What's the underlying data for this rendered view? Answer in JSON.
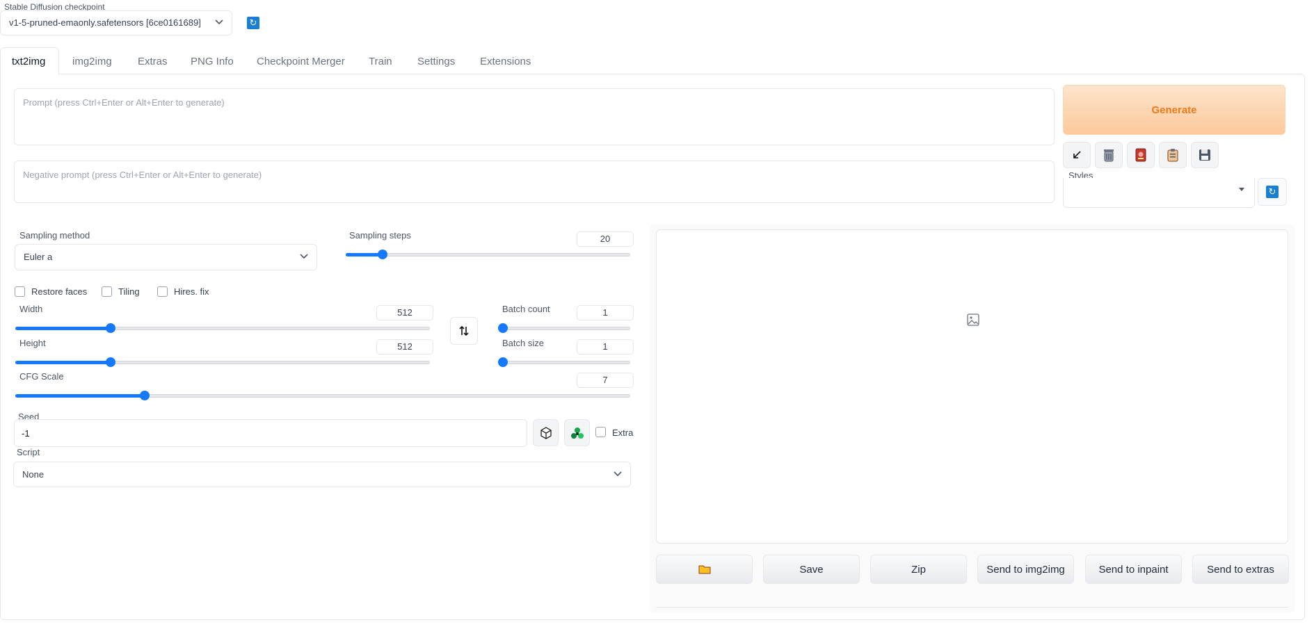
{
  "checkpoint": {
    "label": "Stable Diffusion checkpoint",
    "selected": "v1-5-pruned-emaonly.safetensors [6ce0161689]"
  },
  "tabs": [
    "txt2img",
    "img2img",
    "Extras",
    "PNG Info",
    "Checkpoint Merger",
    "Train",
    "Settings",
    "Extensions"
  ],
  "active_tab": "txt2img",
  "prompt": {
    "placeholder": "Prompt (press Ctrl+Enter or Alt+Enter to generate)",
    "value": ""
  },
  "negative_prompt": {
    "placeholder": "Negative prompt (press Ctrl+Enter or Alt+Enter to generate)",
    "value": ""
  },
  "generate_label": "Generate",
  "tool_icons": [
    "arrow-icon",
    "trash-icon",
    "red-card-icon",
    "clipboard-icon",
    "save-floppy-icon"
  ],
  "styles": {
    "label": "Styles",
    "selected": ""
  },
  "sampling_method": {
    "label": "Sampling method",
    "selected": "Euler a"
  },
  "sampling_steps": {
    "label": "Sampling steps",
    "value": "20",
    "fraction": 0.13
  },
  "checkboxes": {
    "restore_faces": "Restore faces",
    "tiling": "Tiling",
    "hires_fix": "Hires. fix"
  },
  "width": {
    "label": "Width",
    "value": "512",
    "fraction": 0.23
  },
  "height": {
    "label": "Height",
    "value": "512",
    "fraction": 0.23
  },
  "batch_count": {
    "label": "Batch count",
    "value": "1",
    "fraction": 0.0
  },
  "batch_size": {
    "label": "Batch size",
    "value": "1",
    "fraction": 0.0
  },
  "cfg_scale": {
    "label": "CFG Scale",
    "value": "7",
    "fraction": 0.21
  },
  "seed": {
    "label": "Seed",
    "value": "-1",
    "extra_label": "Extra"
  },
  "script": {
    "label": "Script",
    "selected": "None"
  },
  "output_buttons": {
    "folder_icon": "folder-icon",
    "save": "Save",
    "zip": "Zip",
    "send_img2img": "Send to img2img",
    "send_inpaint": "Send to inpaint",
    "send_extras": "Send to extras"
  },
  "colors": {
    "accent": "#1677ff",
    "generate_text": "#ea7a1b",
    "generate_bg": "#fcd3ad"
  }
}
